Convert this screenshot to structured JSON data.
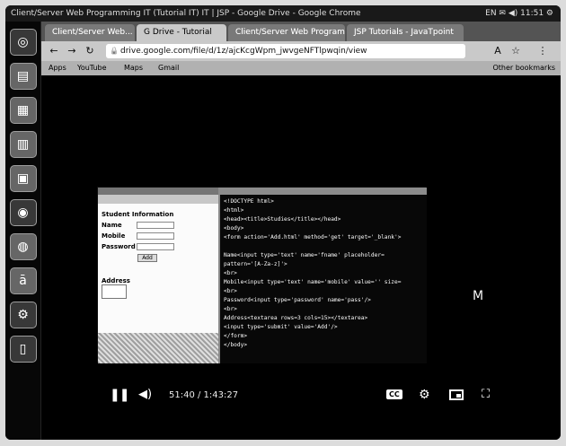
{
  "window": {
    "title": "Client/Server Web Programming IT (Tutorial IT) IT | JSP - Google Drive - Google Chrome",
    "tray": "EN  ✉  ◀)  11:51 ⚙"
  },
  "browser": {
    "tabs": [
      {
        "label": "Client/Server Web..."
      },
      {
        "label": "G Drive - Tutorial"
      },
      {
        "label": "Client/Server Web Programming"
      },
      {
        "label": "JSP Tutorials - JavaTpoint"
      }
    ],
    "url": "drive.google.com/file/d/1z/ajcKcgWpm_jwvgeNFTlpwqin/view",
    "bookmarks": [
      "Apps",
      "YouTube",
      "Maps",
      "Gmail"
    ],
    "other_bookmarks": "Other bookmarks"
  },
  "video": {
    "form": {
      "labels": [
        "Name",
        "Mobile",
        "Password",
        "Address"
      ],
      "submit_label": "Add",
      "header": "Student Information"
    },
    "code_lines": [
      "<!DOCTYPE html>",
      "<html>",
      "<head><title>Studies</title></head>",
      "<body>",
      "<form action='Add.html' method='get' target='_blank'>",
      "",
      "Name<input type='text' name='fname' placeholder=",
      "pattern='[A-Za-z]'>",
      "<br>",
      "Mobile<input type='text' name='mobile' value='' size=",
      "<br>",
      "Password<input type='password' name='pass'/>",
      "<br>",
      "Address<textarea rows=3 cols=15></textarea>",
      "<input type='submit' value='Add'/>",
      "</form>",
      "</body>"
    ],
    "time": "51:40 / 1:43:27",
    "cc": "CC"
  },
  "overlay_letter": "M"
}
